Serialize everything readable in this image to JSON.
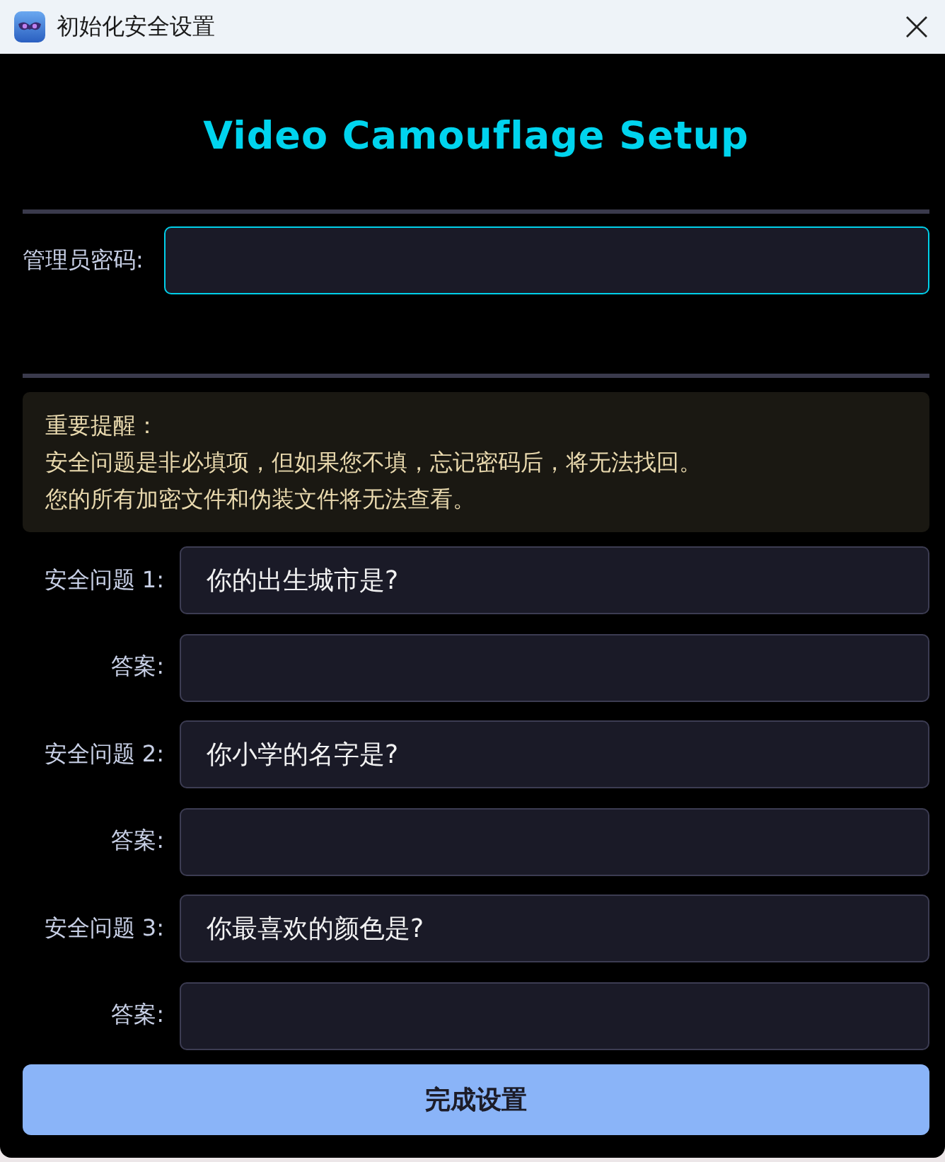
{
  "window": {
    "title": "初始化安全设置"
  },
  "heading": "Video Camouflage Setup",
  "admin_password": {
    "label": "管理员密码:",
    "focused": true
  },
  "notice": {
    "title": "重要提醒：",
    "lines": [
      "安全问题是非必填项，但如果您不填，忘记密码后，将无法找回。",
      "您的所有加密文件和伪装文件将无法查看。"
    ]
  },
  "security_questions": [
    {
      "label": "安全问题 1:",
      "question": "你的出生城市是?",
      "answer_label": "答案:"
    },
    {
      "label": "安全问题 2:",
      "question": "你小学的名字是?",
      "answer_label": "答案:"
    },
    {
      "label": "安全问题 3:",
      "question": "你最喜欢的颜色是?",
      "answer_label": "答案:"
    }
  ],
  "submit_button": "完成设置"
}
